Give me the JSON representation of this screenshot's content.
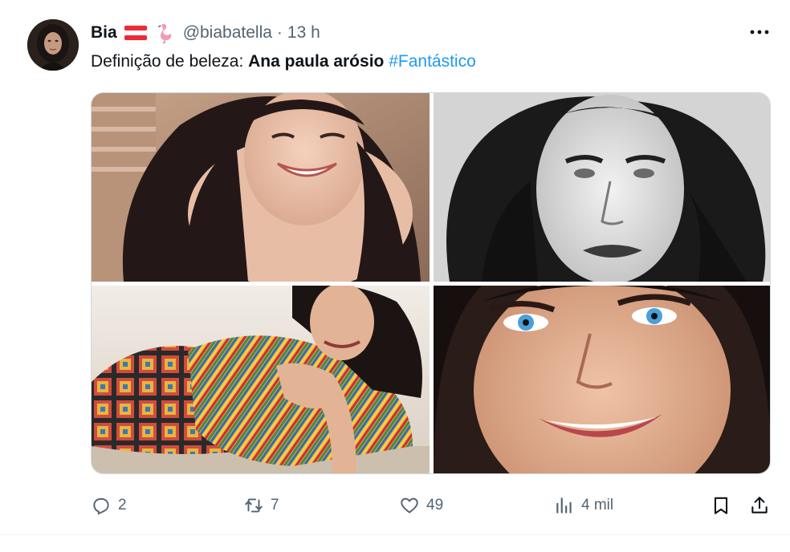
{
  "author": {
    "display_name": "Bia",
    "handle": "@biabatella",
    "separator": "·",
    "time": "13 h",
    "emoji_icons": [
      "austria-flag-icon",
      "flamingo-icon"
    ]
  },
  "tweet": {
    "text_prefix": "Definição de beleza: ",
    "text_bold": "Ana paula arósio",
    "text_space": " ",
    "hashtag": "#Fantástico"
  },
  "media": {
    "photo_count": 4
  },
  "actions": {
    "replies": "2",
    "retweets": "7",
    "likes": "49",
    "views": "4 mil"
  },
  "colors": {
    "accent": "#1d9bf0",
    "muted": "#536471",
    "text": "#0f1419",
    "flag_red": "#ed2939"
  }
}
